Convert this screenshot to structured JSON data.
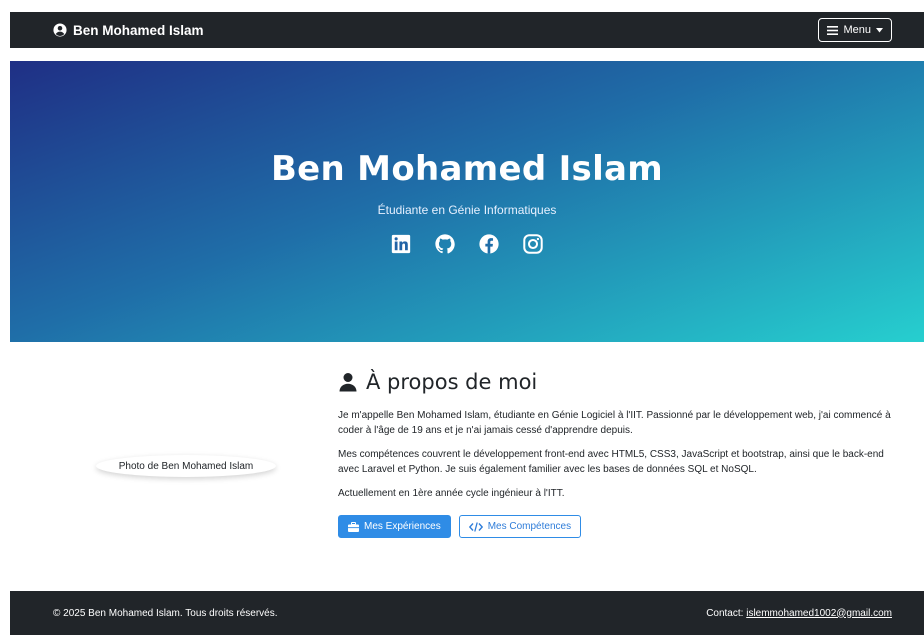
{
  "navbar": {
    "brand_icon": "user-circle-icon",
    "brand": "Ben Mohamed Islam",
    "menu_icon": "bars-icon",
    "menu_label": "Menu",
    "caret_icon": "caret-down-icon"
  },
  "hero": {
    "title": "Ben Mohamed Islam",
    "subtitle": "Étudiante en Génie Informatiques",
    "socials": [
      "linkedin-icon",
      "github-icon",
      "facebook-icon",
      "instagram-icon"
    ],
    "gradient": [
      "#1f2f85",
      "#1f6ea8",
      "#26cfcf"
    ]
  },
  "photo": {
    "alt": "Photo de Ben Mohamed Islam"
  },
  "about": {
    "title_icon": "user-icon",
    "title": "À propos de moi",
    "paragraphs": [
      "Je m'appelle Ben Mohamed Islam, étudiante en Génie Logiciel à l'IIT. Passionné par le développement web, j'ai commencé à coder à l'âge de 19 ans et je n'ai jamais cessé d'apprendre depuis.",
      "Mes compétences couvrent le développement front-end avec HTML5, CSS3, JavaScript et bootstrap, ainsi que le back-end avec Laravel et Python. Je suis également familier avec les bases de données SQL et NoSQL.",
      "Actuellement en 1ère année cycle ingénieur à l'ITT."
    ],
    "buttons": {
      "experiences": "Mes Expériences",
      "experiences_icon": "briefcase-icon",
      "competences": "Mes Compétences",
      "competences_icon": "code-icon"
    }
  },
  "footer": {
    "copyright": "© 2025 Ben Mohamed Islam. Tous droits réservés.",
    "contact_label": "Contact: ",
    "email": "islemmohamed1002@gmail.com"
  },
  "colors": {
    "dark": "#212529",
    "primary": "#2f8ce6"
  }
}
